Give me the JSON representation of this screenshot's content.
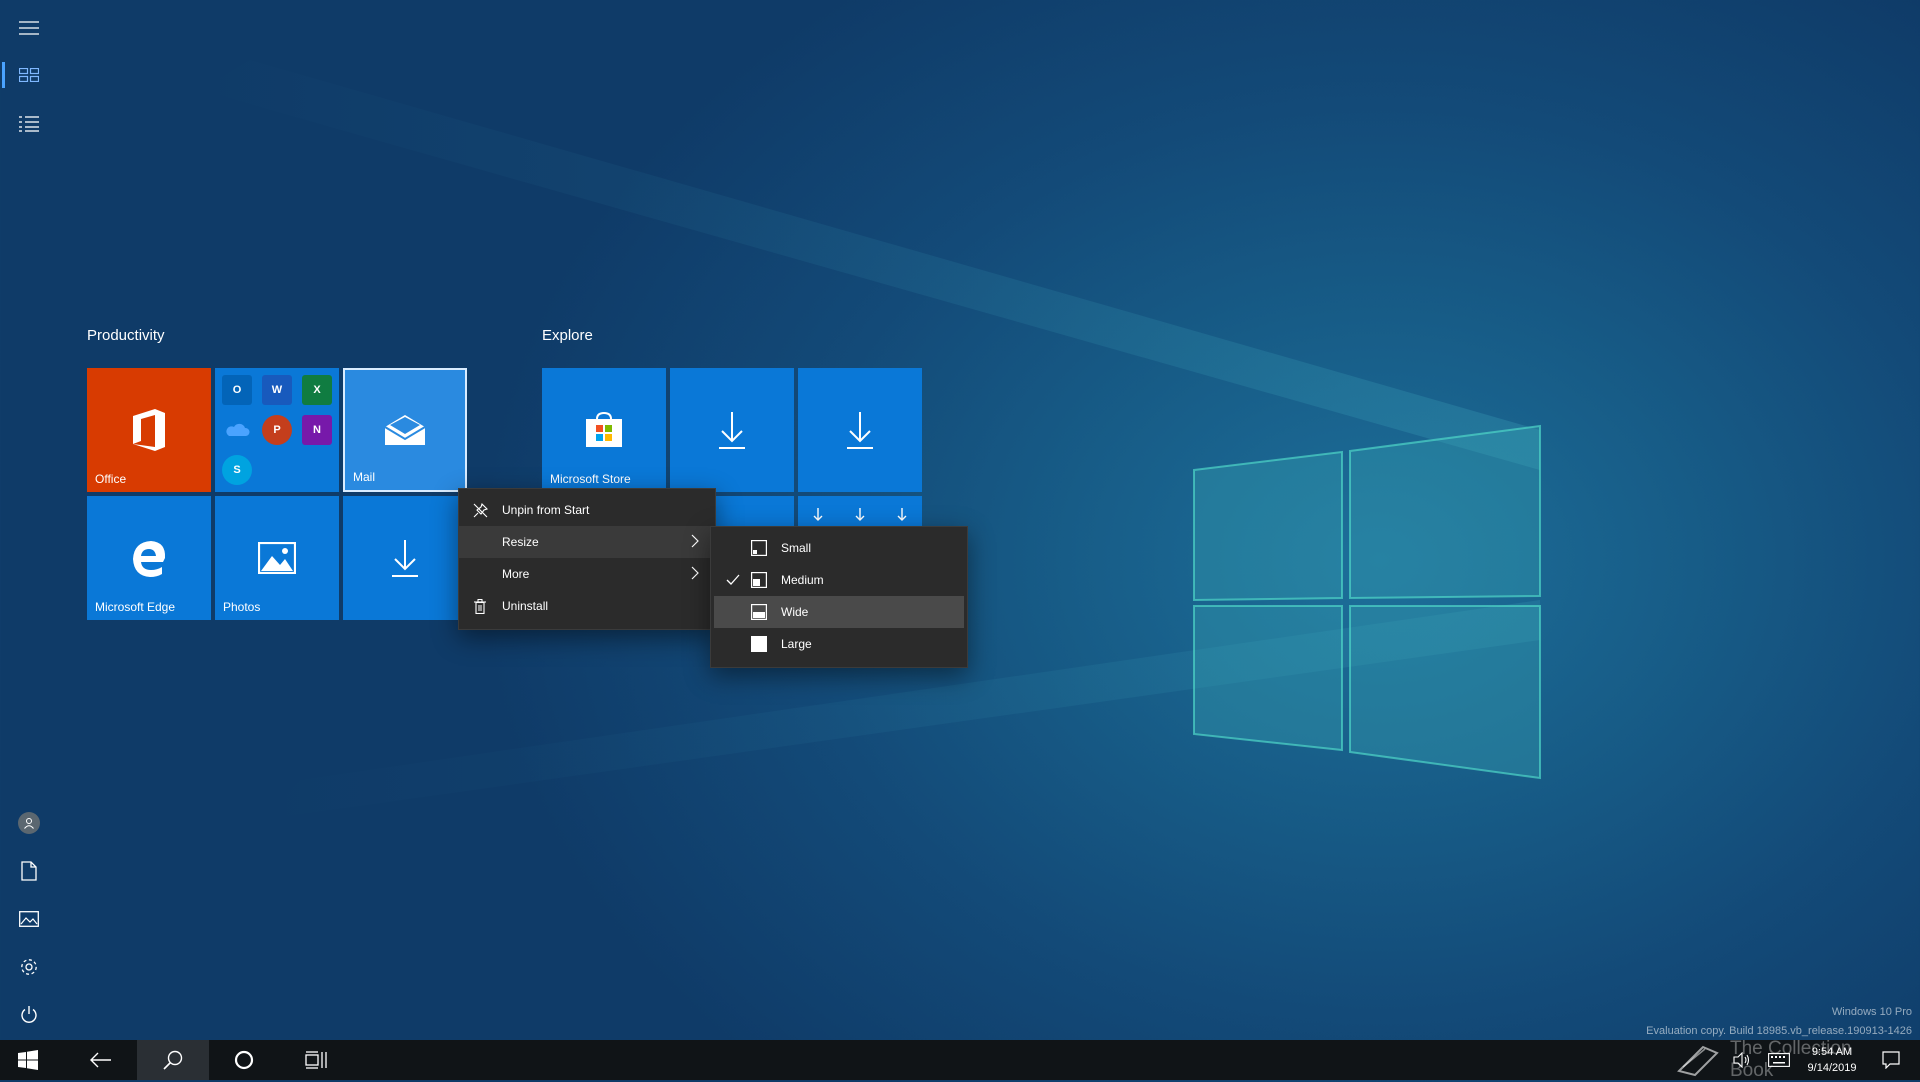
{
  "groups": [
    {
      "title": "Productivity"
    },
    {
      "title": "Explore"
    }
  ],
  "tiles": {
    "office": "Office",
    "mail": "Mail",
    "edge": "Microsoft Edge",
    "photos": "Photos",
    "store": "Microsoft Store",
    "office_apps": [
      "O",
      "W",
      "X",
      "",
      "P",
      "N",
      "S"
    ]
  },
  "context_menu": {
    "items": [
      "Unpin from Start",
      "Resize",
      "More",
      "Uninstall"
    ]
  },
  "resize_menu": {
    "items": [
      "Small",
      "Medium",
      "Wide",
      "Large"
    ],
    "checked": "Medium",
    "highlighted": "Wide"
  },
  "watermark": {
    "edition": "Windows 10 Pro",
    "build": "Evaluation copy. Build 18985.vb_release.190913-1426"
  },
  "taskbar": {
    "time": "9:54 AM",
    "date": "9/14/2019",
    "overlay_text": "The Collection Book"
  },
  "colors": {
    "tile_blue": "#0a78d7",
    "office_red": "#d83b01",
    "menu_bg": "#2b2b2b",
    "taskbar_bg": "#101417"
  }
}
